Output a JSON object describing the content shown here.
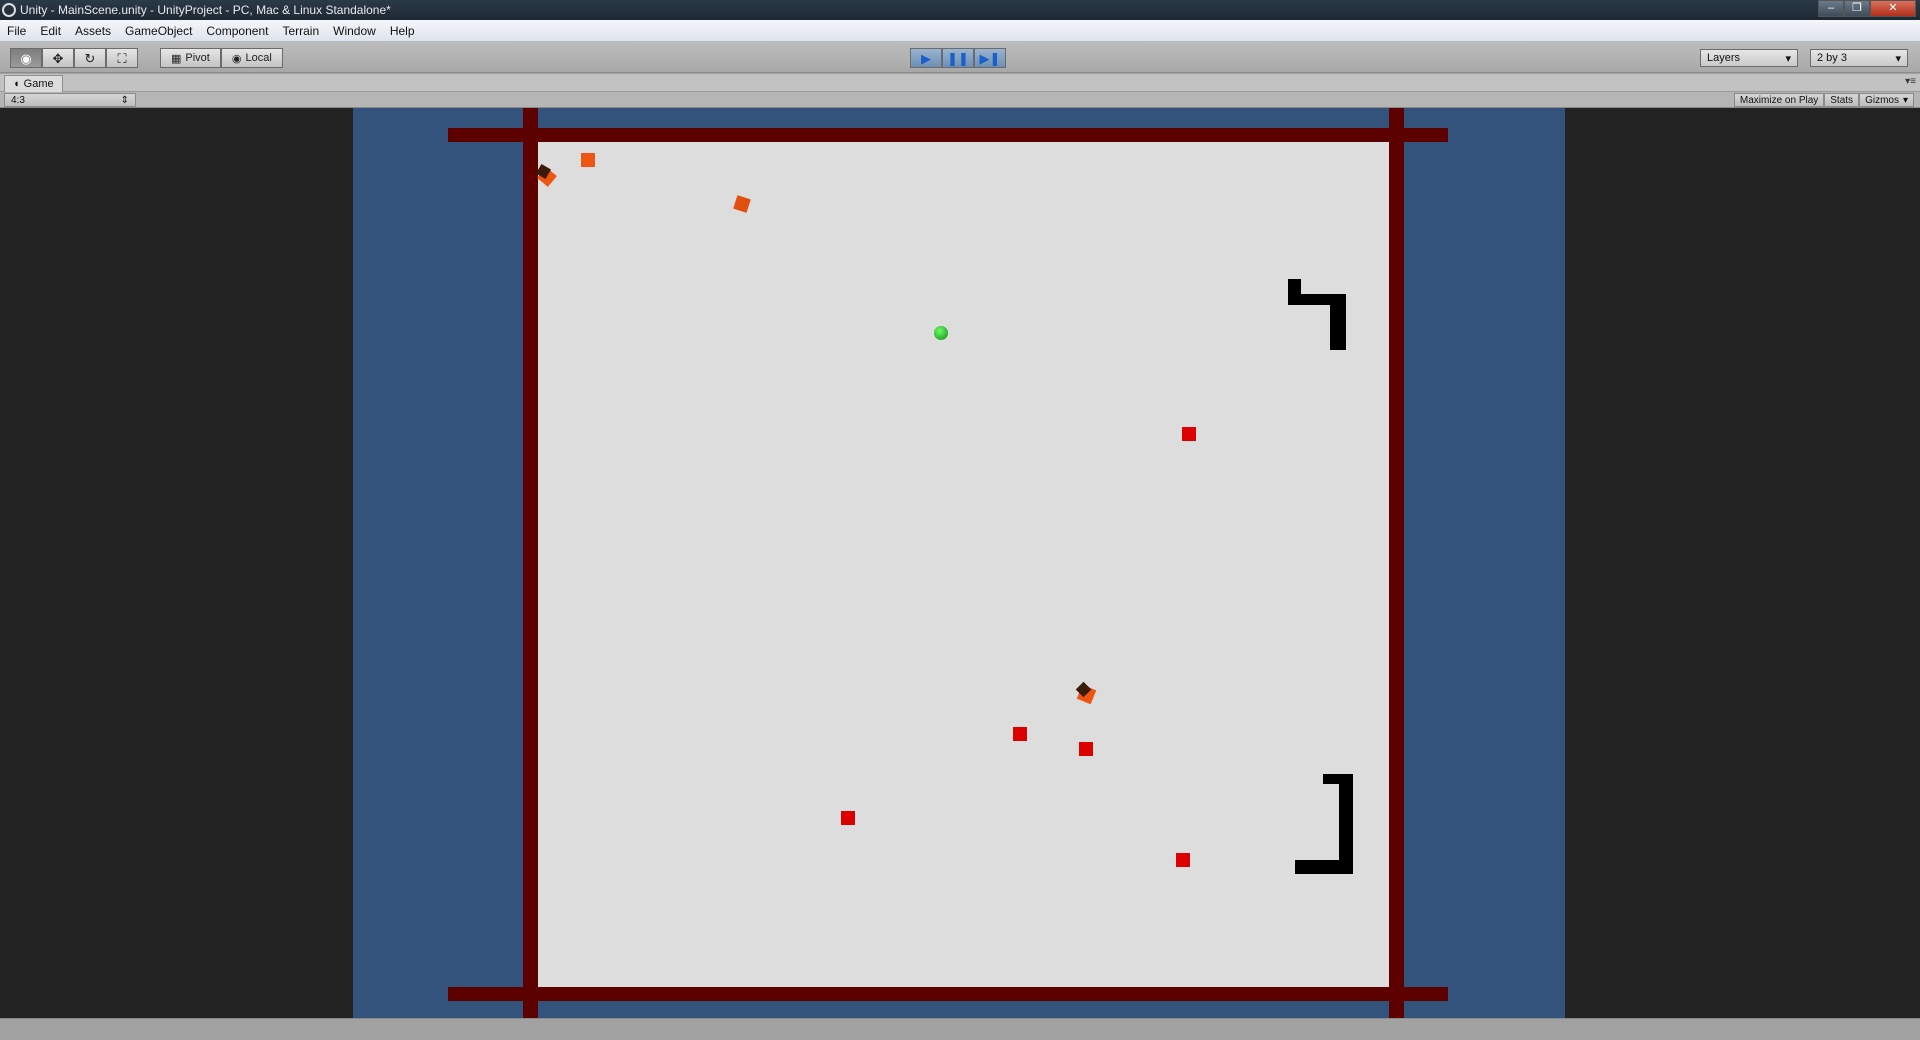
{
  "window": {
    "title": "Unity - MainScene.unity - UnityProject - PC, Mac & Linux Standalone*"
  },
  "menu": [
    "File",
    "Edit",
    "Assets",
    "GameObject",
    "Component",
    "Terrain",
    "Window",
    "Help"
  ],
  "toolbar": {
    "tools": [
      {
        "name": "view-tool",
        "icon": "eye-icon",
        "glyph": "◉"
      },
      {
        "name": "move-tool",
        "icon": "move-arrows-icon",
        "glyph": "✥"
      },
      {
        "name": "rotate-tool",
        "icon": "rotate-icon",
        "glyph": "↻"
      },
      {
        "name": "scale-tool",
        "icon": "scale-icon",
        "glyph": "⛶"
      }
    ],
    "pivot_label": "Pivot",
    "local_label": "Local",
    "play_state": "playing",
    "layers_label": "Layers",
    "layout_label": "2 by 3"
  },
  "game_view": {
    "tab_label": "Game",
    "aspect_label": "4:3",
    "maximize_label": "Maximize on Play",
    "stats_label": "Stats",
    "gizmos_label": "Gizmos"
  },
  "scene": {
    "colors": {
      "editor_bg": "#222222",
      "camera_bg": "#34537c",
      "floor": "#dddddd",
      "wall": "#5c0000",
      "enemy": "#dd0000",
      "pickup": "#ee5511",
      "player": "#22bb22",
      "obstacle": "#000000"
    }
  }
}
